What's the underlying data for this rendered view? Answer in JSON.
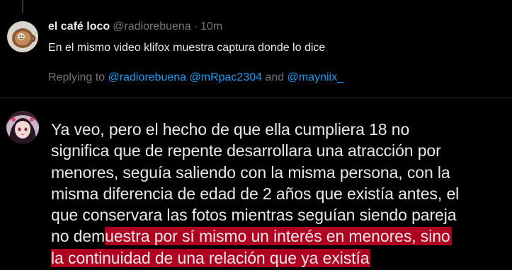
{
  "tweet_parent": {
    "display_name": "el café loco",
    "handle": "@radiorebuena",
    "separator": "·",
    "time": "10m",
    "text": "En el mismo video klifox muestra captura donde lo dice",
    "avatar_icon": "coffee-cup-avatar-icon"
  },
  "replying": {
    "prefix": "Replying to ",
    "mention_1": "@radiorebuena",
    "mention_2": "@mRpac2304",
    "conjunction": " and ",
    "mention_3": "@mayniix_"
  },
  "reply": {
    "avatar_icon": "anime-character-avatar-icon",
    "lines": [
      "Ya veo, pero el hecho de que ella cumpliera 18 no",
      "significa que de repente desarrollara una atracción por",
      "menores, seguía saliendo con la misma persona, con la",
      "misma diferencia de edad de 2 años que existía antes, el",
      "que conservara las fotos mientras seguían siendo pareja"
    ],
    "line6_plain": "no dem",
    "line6_highlight": "uestra por sí mismo un interés en menores, sino",
    "line7_highlight": "la continuidad de una relación que ya existía"
  },
  "colors": {
    "background": "#000000",
    "text_primary": "#e7e9ea",
    "text_secondary": "#71767b",
    "link": "#1d9bf0",
    "highlight": "#b00020",
    "divider": "#2f3336"
  }
}
